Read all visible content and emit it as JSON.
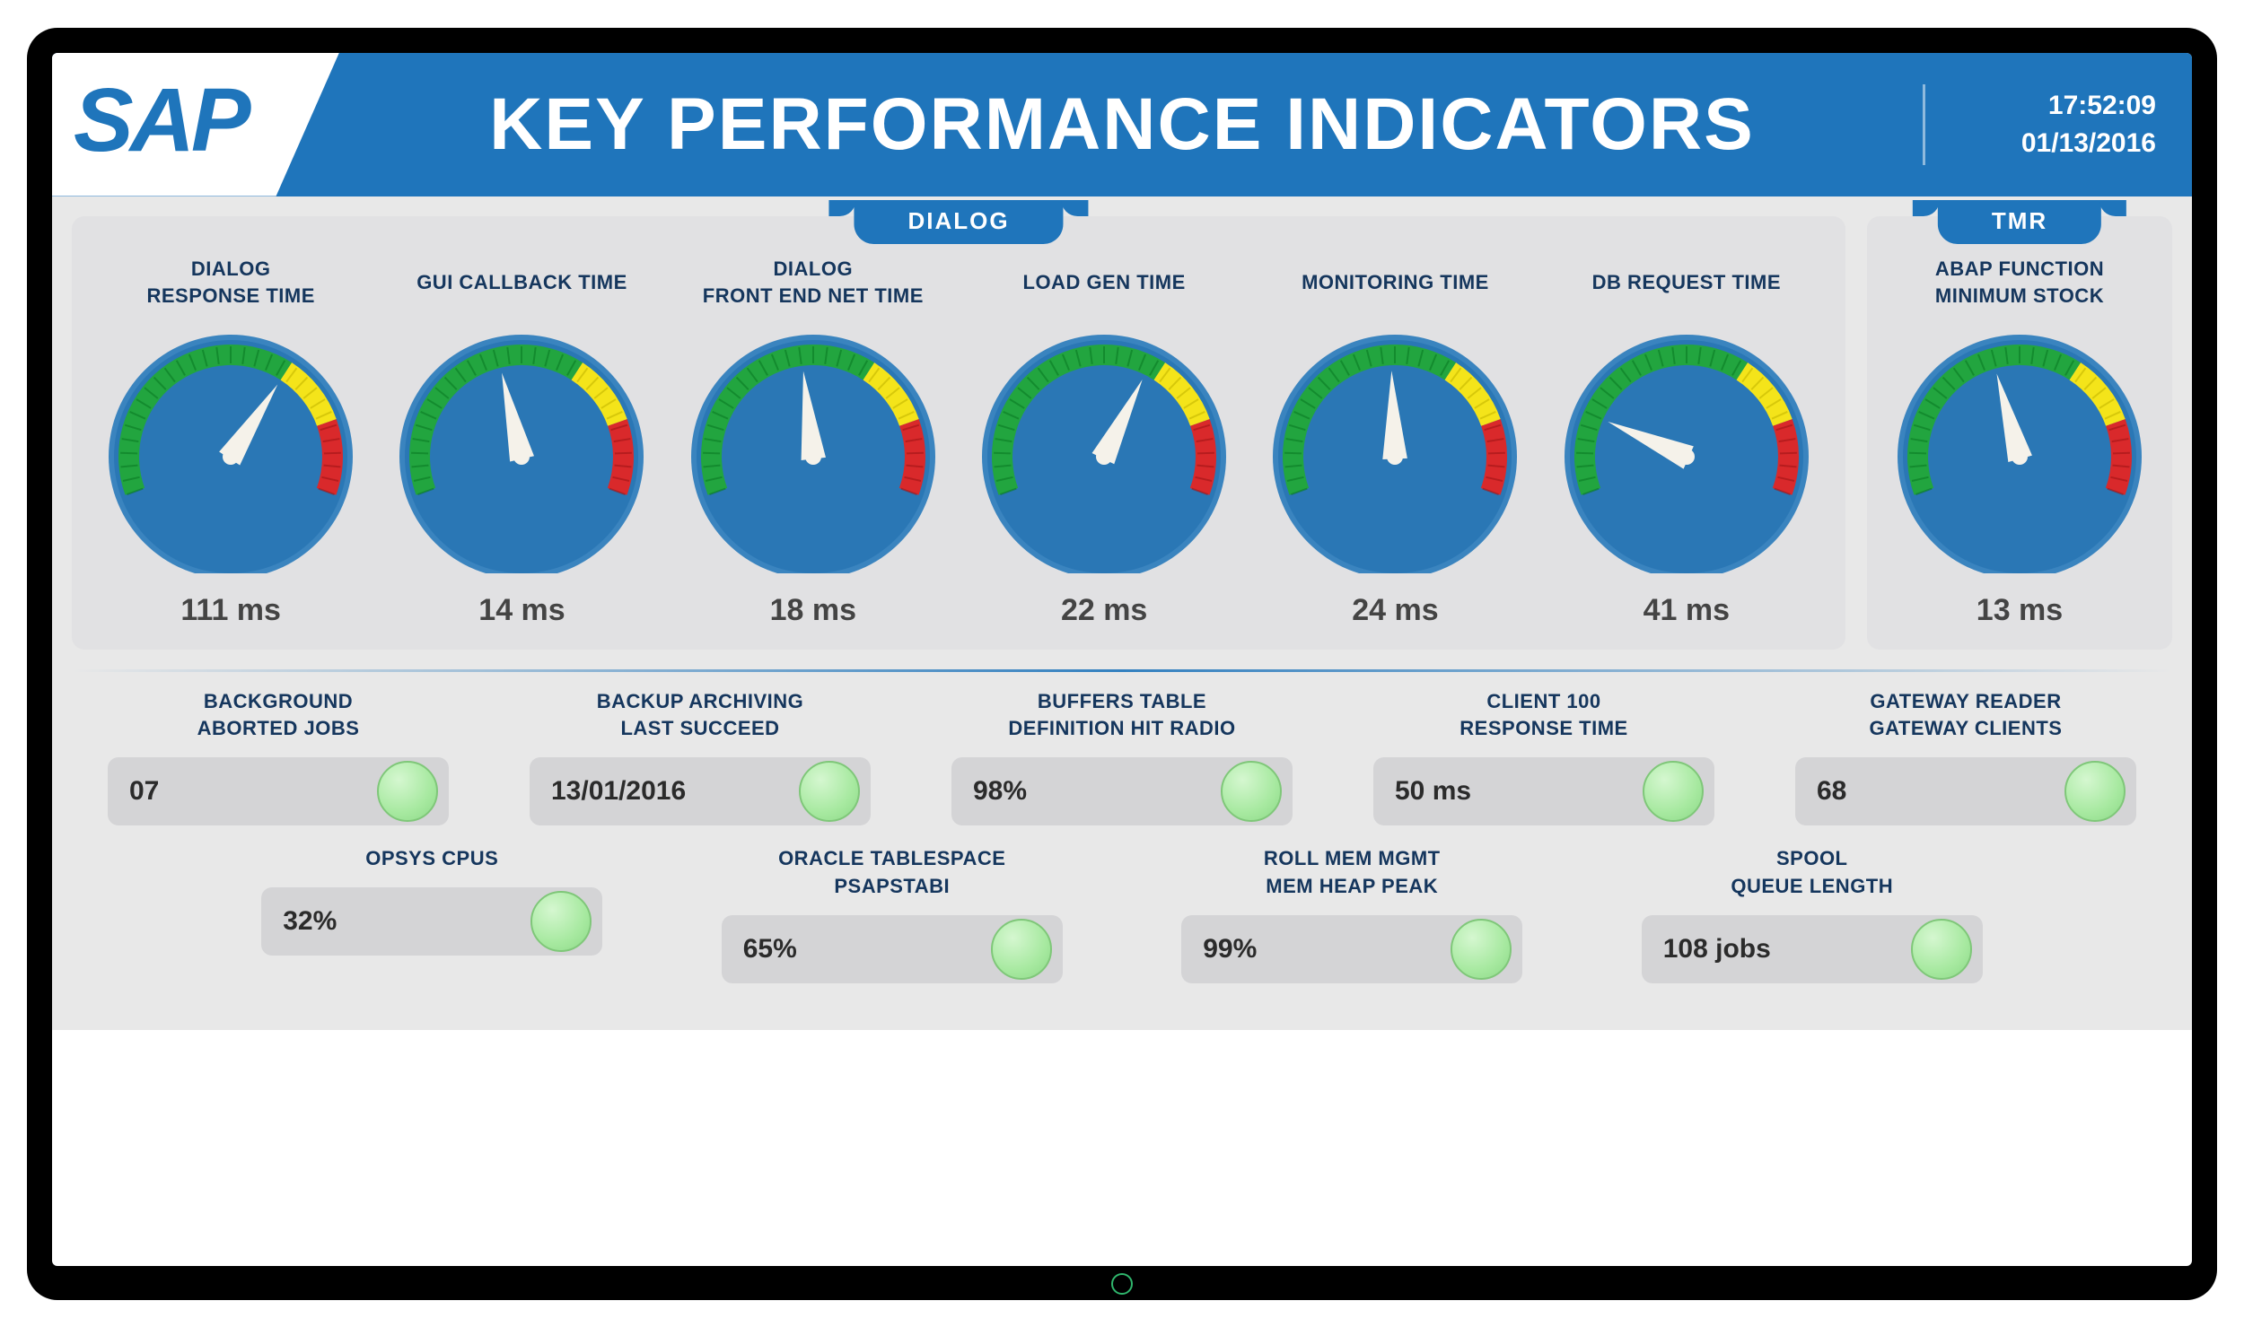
{
  "header": {
    "logo": "SAP",
    "title": "KEY PERFORMANCE INDICATORS",
    "time": "17:52:09",
    "date": "01/13/2016"
  },
  "panels": {
    "dialog": {
      "tab": "DIALOG",
      "gauges": [
        {
          "title": "DIALOG\nRESPONSE TIME",
          "value": "111 ms",
          "pct": 0.65
        },
        {
          "title": "GUI CALLBACK TIME",
          "value": "14 ms",
          "pct": 0.44
        },
        {
          "title": "DIALOG\nFRONT END NET TIME",
          "value": "18 ms",
          "pct": 0.47
        },
        {
          "title": "LOAD GEN TIME",
          "value": "22 ms",
          "pct": 0.62
        },
        {
          "title": "MONITORING TIME",
          "value": "24 ms",
          "pct": 0.49
        },
        {
          "title": "DB REQUEST TIME",
          "value": "41 ms",
          "pct": 0.2
        }
      ]
    },
    "tmr": {
      "tab": "TMR",
      "gauges": [
        {
          "title": "ABAP FUNCTION\nMINIMUM STOCK",
          "value": "13 ms",
          "pct": 0.43
        }
      ]
    }
  },
  "status": {
    "row1": [
      {
        "title": "BACKGROUND\nABORTED JOBS",
        "value": "07",
        "state": "ok"
      },
      {
        "title": "BACKUP ARCHIVING\nLAST SUCCEED",
        "value": "13/01/2016",
        "state": "ok"
      },
      {
        "title": "BUFFERS TABLE\nDEFINITION HIT RADIO",
        "value": "98%",
        "state": "ok"
      },
      {
        "title": "CLIENT 100\nRESPONSE TIME",
        "value": "50 ms",
        "state": "ok"
      },
      {
        "title": "GATEWAY READER\nGATEWAY CLIENTS",
        "value": "68",
        "state": "ok"
      }
    ],
    "row2": [
      {
        "title": "OPSYS CPUS",
        "value": "32%",
        "state": "ok"
      },
      {
        "title": "ORACLE TABLESPACE\nPSAPSTABI",
        "value": "65%",
        "state": "ok"
      },
      {
        "title": "ROLL MEM MGMT\nMEM HEAP PEAK",
        "value": "99%",
        "state": "ok"
      },
      {
        "title": "SPOOL\nQUEUE LENGTH",
        "value": "108 jobs",
        "state": "ok"
      }
    ]
  },
  "chart_data": [
    {
      "type": "gauge",
      "title": "DIALOG RESPONSE TIME",
      "value": 111,
      "unit": "ms",
      "range": [
        0,
        170
      ],
      "zones": {
        "green": [
          0,
          110
        ],
        "yellow": [
          110,
          140
        ],
        "red": [
          140,
          170
        ]
      }
    },
    {
      "type": "gauge",
      "title": "GUI CALLBACK TIME",
      "value": 14,
      "unit": "ms",
      "range": [
        0,
        32
      ],
      "zones": {
        "green": [
          0,
          21
        ],
        "yellow": [
          21,
          26
        ],
        "red": [
          26,
          32
        ]
      }
    },
    {
      "type": "gauge",
      "title": "DIALOG FRONT END NET TIME",
      "value": 18,
      "unit": "ms",
      "range": [
        0,
        38
      ],
      "zones": {
        "green": [
          0,
          25
        ],
        "yellow": [
          25,
          31
        ],
        "red": [
          31,
          38
        ]
      }
    },
    {
      "type": "gauge",
      "title": "LOAD GEN TIME",
      "value": 22,
      "unit": "ms",
      "range": [
        0,
        35
      ],
      "zones": {
        "green": [
          0,
          23
        ],
        "yellow": [
          23,
          29
        ],
        "red": [
          29,
          35
        ]
      }
    },
    {
      "type": "gauge",
      "title": "MONITORING TIME",
      "value": 24,
      "unit": "ms",
      "range": [
        0,
        49
      ],
      "zones": {
        "green": [
          0,
          32
        ],
        "yellow": [
          32,
          40
        ],
        "red": [
          40,
          49
        ]
      }
    },
    {
      "type": "gauge",
      "title": "DB REQUEST TIME",
      "value": 41,
      "unit": "ms",
      "range": [
        0,
        205
      ],
      "zones": {
        "green": [
          0,
          133
        ],
        "yellow": [
          133,
          169
        ],
        "red": [
          169,
          205
        ]
      }
    },
    {
      "type": "gauge",
      "title": "ABAP FUNCTION MINIMUM STOCK",
      "value": 13,
      "unit": "ms",
      "range": [
        0,
        30
      ],
      "zones": {
        "green": [
          0,
          20
        ],
        "yellow": [
          20,
          25
        ],
        "red": [
          25,
          30
        ]
      }
    }
  ]
}
